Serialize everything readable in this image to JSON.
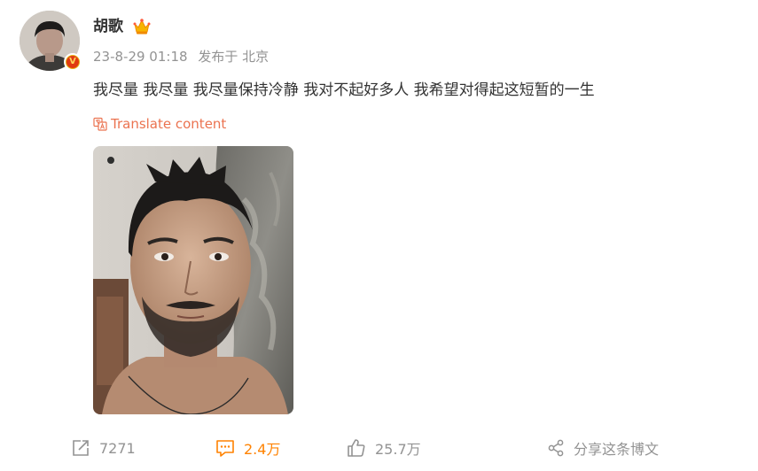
{
  "post": {
    "author": "胡歌",
    "timestamp": "23-8-29 01:18",
    "location": "发布于 北京",
    "text": "我尽量 我尽量 我尽量保持冷静 我对不起好多人 我希望对得起这短暂的一生",
    "translate_label": "Translate content",
    "verified_badge": "V"
  },
  "actions": {
    "repost_count": "7271",
    "comment_count": "2.4万",
    "like_count": "25.7万",
    "share_label": "分享这条博文"
  },
  "colors": {
    "accent_orange": "#ff8200",
    "translate": "#eb7350",
    "meta_gray": "#939393",
    "text": "#333333",
    "verified_gold": "#e8b312"
  }
}
